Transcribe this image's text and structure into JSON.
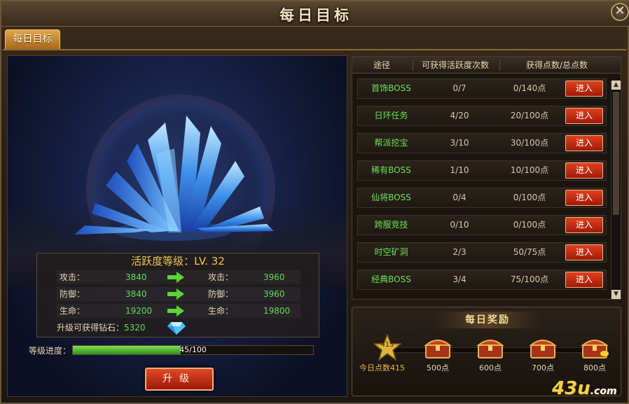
{
  "window": {
    "title": "每日目标",
    "close_label": "✕"
  },
  "tabs": [
    {
      "label": "每日目标"
    }
  ],
  "left": {
    "level_text": "活跃度等级：LV. 32",
    "stats": [
      {
        "label": "攻击：",
        "current": "3840",
        "next_label": "攻击：",
        "next": "3960"
      },
      {
        "label": "防御：",
        "current": "3840",
        "next_label": "防御：",
        "next": "3960"
      },
      {
        "label": "生命：",
        "current": "19200",
        "next_label": "生命：",
        "next": "19800"
      }
    ],
    "diamond_label": "升级可获得钻石：",
    "diamond_value": "5320",
    "progress_label": "等级进度：",
    "progress_text": "45/100",
    "progress_fraction": 0.45,
    "upgrade_label": "升级"
  },
  "table": {
    "headers": [
      "途径",
      "可获得活跃度次数",
      "获得点数/总点数"
    ],
    "rows": [
      {
        "name": "首饰BOSS",
        "count": "0/7",
        "points": "0/140点",
        "action": "进入"
      },
      {
        "name": "日环任务",
        "count": "4/20",
        "points": "20/100点",
        "action": "进入"
      },
      {
        "name": "帮派挖宝",
        "count": "3/10",
        "points": "30/100点",
        "action": "进入"
      },
      {
        "name": "稀有BOSS",
        "count": "1/10",
        "points": "10/100点",
        "action": "进入"
      },
      {
        "name": "仙将BOSS",
        "count": "0/4",
        "points": "0/100点",
        "action": "进入"
      },
      {
        "name": "跨服竞技",
        "count": "0/10",
        "points": "0/100点",
        "action": "进入"
      },
      {
        "name": "时空矿洞",
        "count": "2/3",
        "points": "50/75点",
        "action": "进入"
      },
      {
        "name": "经典BOSS",
        "count": "3/4",
        "points": "75/100点",
        "action": "进入"
      }
    ],
    "scroll_up": "▲",
    "scroll_down": "▼"
  },
  "rewards": {
    "title": "每日奖励",
    "star_value": "415",
    "today_label": "今日点数415",
    "chests": [
      "500点",
      "600点",
      "700点",
      "800点"
    ]
  },
  "watermark": {
    "main": "43u",
    "suffix": ".com"
  },
  "colors": {
    "accent_gold": "#f2c654",
    "stat_green": "#66d95a",
    "button_red": "#c22d10"
  }
}
